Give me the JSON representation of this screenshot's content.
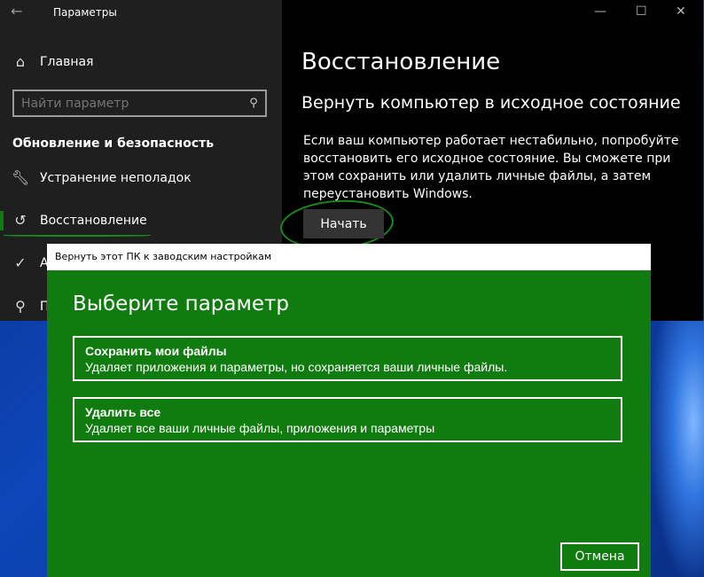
{
  "window": {
    "title": "Параметры",
    "controls": {
      "minimize": "—",
      "maximize": "☐",
      "close": "✕"
    }
  },
  "sidebar": {
    "home": "Главная",
    "search_placeholder": "Найти параметр",
    "section": "Обновление и безопасность",
    "items": [
      {
        "label": "Устранение неполадок",
        "icon": "wrench-icon"
      },
      {
        "label": "Восстановление",
        "icon": "history-icon",
        "selected": true
      },
      {
        "label": "А",
        "icon": "check-circle-icon"
      },
      {
        "label": "П",
        "icon": "person-icon"
      }
    ]
  },
  "content": {
    "title": "Восстановление",
    "subtitle": "Вернуть компьютер в исходное состояние",
    "text": "Если ваш компьютер работает нестабильно, попробуйте восстановить его исходное состояние. Вы сможете при этом сохранить или удалить личные файлы, а затем переустановить Windows.",
    "start_label": "Начать"
  },
  "dialog": {
    "title": "Вернуть этот ПК к заводским настройкам",
    "heading": "Выберите параметр",
    "options": [
      {
        "title": "Сохранить мои файлы",
        "desc": "Удаляет приложения и параметры, но сохраняется ваши личные файлы."
      },
      {
        "title": "Удалить все",
        "desc": "Удаляет все ваши личные файлы, приложения и параметры"
      }
    ],
    "cancel_label": "Отмена"
  },
  "colors": {
    "accent": "#107c10",
    "annotation": "#1a8a1a",
    "sidebar_bg": "#1f1f1f"
  }
}
